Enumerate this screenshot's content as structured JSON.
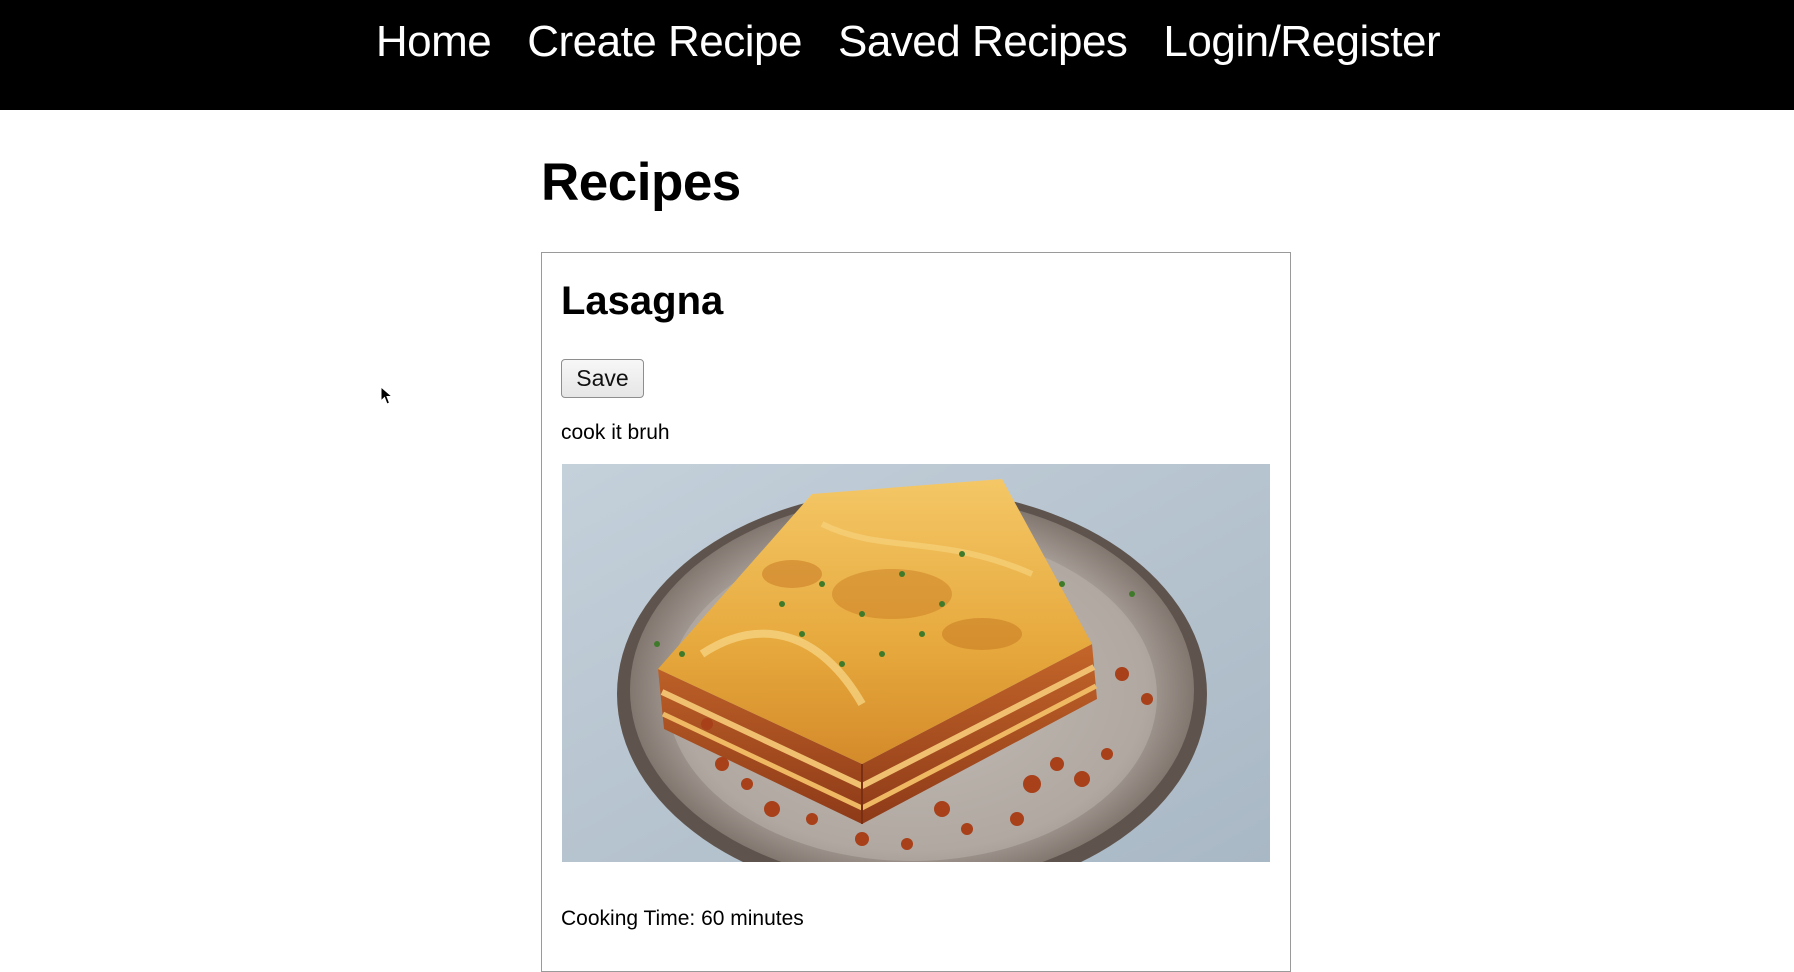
{
  "nav": {
    "items": [
      {
        "label": "Home"
      },
      {
        "label": "Create Recipe"
      },
      {
        "label": "Saved Recipes"
      },
      {
        "label": "Login/Register"
      }
    ]
  },
  "page": {
    "title": "Recipes"
  },
  "recipes": [
    {
      "name": "Lasagna",
      "save_label": "Save",
      "instructions": "cook it bruh",
      "image_subject": "lasagna-on-plate",
      "cooking_time_label": "Cooking Time:",
      "cooking_time_value": "60 minutes"
    }
  ],
  "colors": {
    "navbar_bg": "#000000",
    "nav_text": "#ffffff",
    "card_border": "#9a9a9a",
    "image_backdrop": "#b8c6d2"
  }
}
